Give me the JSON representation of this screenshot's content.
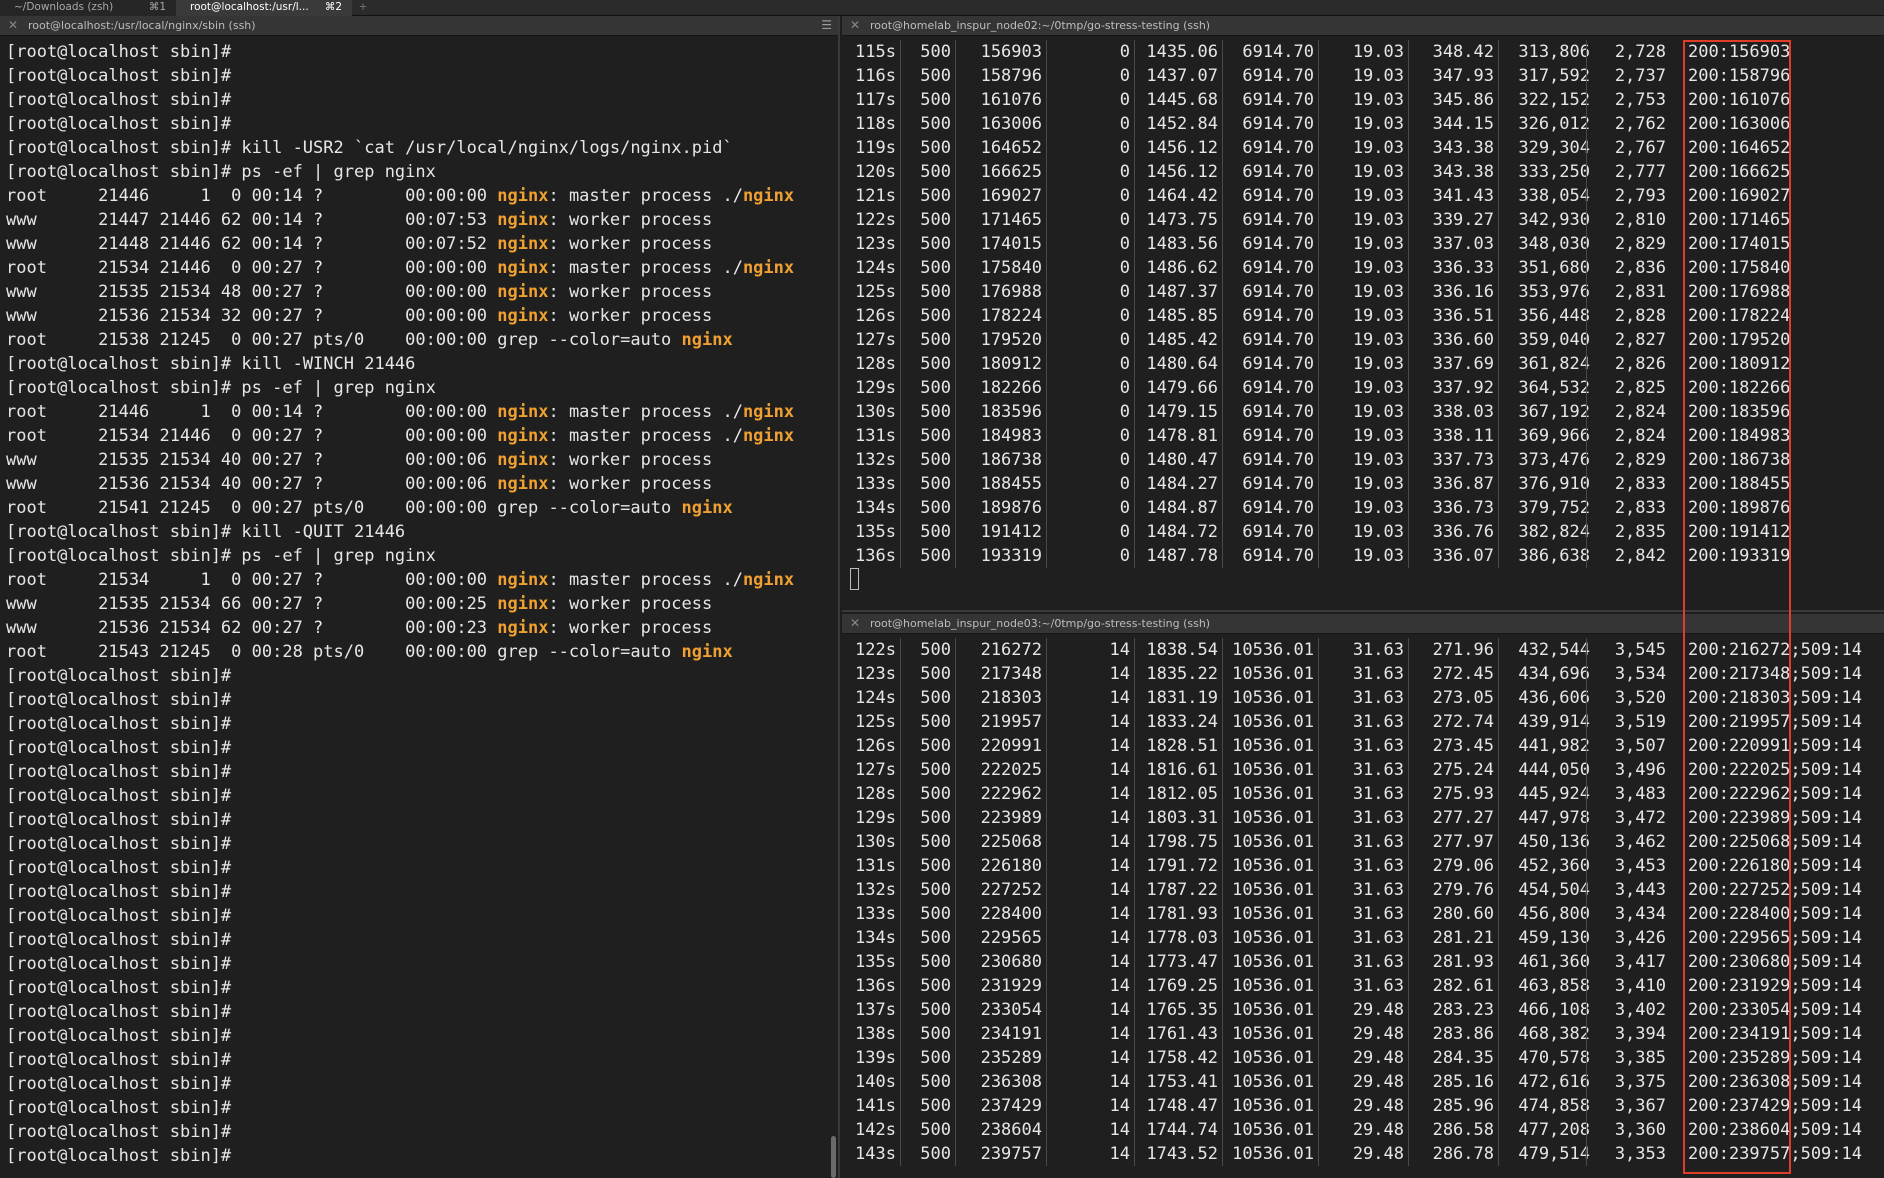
{
  "tabs": [
    {
      "title": "~/Downloads (zsh)",
      "shortcut": "⌘1"
    },
    {
      "title": "root@localhost:/usr/l...",
      "shortcut": "⌘2"
    }
  ],
  "tab_add_label": "+",
  "panes": {
    "left_title": "root@localhost:/usr/local/nginx/sbin (ssh)",
    "top_right_title": "root@homelab_inspur_node02:~/0tmp/go-stress-testing (ssh)",
    "bottom_right_title": "root@homelab_inspur_node03:~/0tmp/go-stress-testing (ssh)"
  },
  "icons": {
    "close": "close-icon",
    "menu": "hamburger-icon"
  },
  "colors": {
    "highlight": "#f0a030",
    "annotation_box": "#e03c28"
  },
  "left_lines": [
    "[root@localhost sbin]#",
    "[root@localhost sbin]#",
    "[root@localhost sbin]#",
    "[root@localhost sbin]#",
    "[root@localhost sbin]# kill -USR2 `cat /usr/local/nginx/logs/nginx.pid`",
    "[root@localhost sbin]# ps -ef | grep nginx",
    "root     21446     1  0 00:14 ?        00:00:00 nginx: master process ./nginx",
    "www      21447 21446 62 00:14 ?        00:07:53 nginx: worker process",
    "www      21448 21446 62 00:14 ?        00:07:52 nginx: worker process",
    "root     21534 21446  0 00:27 ?        00:00:00 nginx: master process ./nginx",
    "www      21535 21534 48 00:27 ?        00:00:00 nginx: worker process",
    "www      21536 21534 32 00:27 ?        00:00:00 nginx: worker process",
    "root     21538 21245  0 00:27 pts/0    00:00:00 grep --color=auto nginx",
    "[root@localhost sbin]# kill -WINCH 21446",
    "[root@localhost sbin]# ps -ef | grep nginx",
    "root     21446     1  0 00:14 ?        00:00:00 nginx: master process ./nginx",
    "root     21534 21446  0 00:27 ?        00:00:00 nginx: master process ./nginx",
    "www      21535 21534 40 00:27 ?        00:00:06 nginx: worker process",
    "www      21536 21534 40 00:27 ?        00:00:06 nginx: worker process",
    "root     21541 21245  0 00:27 pts/0    00:00:00 grep --color=auto nginx",
    "[root@localhost sbin]# kill -QUIT 21446",
    "[root@localhost sbin]# ps -ef | grep nginx",
    "root     21534     1  0 00:27 ?        00:00:00 nginx: master process ./nginx",
    "www      21535 21534 66 00:27 ?        00:00:25 nginx: worker process",
    "www      21536 21534 62 00:27 ?        00:00:23 nginx: worker process",
    "root     21543 21245  0 00:28 pts/0    00:00:00 grep --color=auto nginx",
    "[root@localhost sbin]#",
    "[root@localhost sbin]#",
    "[root@localhost sbin]#",
    "[root@localhost sbin]#",
    "[root@localhost sbin]#",
    "[root@localhost sbin]#",
    "[root@localhost sbin]#",
    "[root@localhost sbin]#",
    "[root@localhost sbin]#",
    "[root@localhost sbin]#",
    "[root@localhost sbin]#",
    "[root@localhost sbin]#",
    "[root@localhost sbin]#",
    "[root@localhost sbin]#",
    "[root@localhost sbin]#",
    "[root@localhost sbin]#",
    "[root@localhost sbin]#",
    "[root@localhost sbin]#",
    "[root@localhost sbin]#",
    "[root@localhost sbin]#",
    "[root@localhost sbin]#"
  ],
  "top_rows": [
    [
      "115s",
      "500",
      "156903",
      "0",
      "1435.06",
      "6914.70",
      "19.03",
      "348.42",
      "313,806",
      "2,728",
      "200:156903"
    ],
    [
      "116s",
      "500",
      "158796",
      "0",
      "1437.07",
      "6914.70",
      "19.03",
      "347.93",
      "317,592",
      "2,737",
      "200:158796"
    ],
    [
      "117s",
      "500",
      "161076",
      "0",
      "1445.68",
      "6914.70",
      "19.03",
      "345.86",
      "322,152",
      "2,753",
      "200:161076"
    ],
    [
      "118s",
      "500",
      "163006",
      "0",
      "1452.84",
      "6914.70",
      "19.03",
      "344.15",
      "326,012",
      "2,762",
      "200:163006"
    ],
    [
      "119s",
      "500",
      "164652",
      "0",
      "1456.12",
      "6914.70",
      "19.03",
      "343.38",
      "329,304",
      "2,767",
      "200:164652"
    ],
    [
      "120s",
      "500",
      "166625",
      "0",
      "1456.12",
      "6914.70",
      "19.03",
      "343.38",
      "333,250",
      "2,777",
      "200:166625"
    ],
    [
      "121s",
      "500",
      "169027",
      "0",
      "1464.42",
      "6914.70",
      "19.03",
      "341.43",
      "338,054",
      "2,793",
      "200:169027"
    ],
    [
      "122s",
      "500",
      "171465",
      "0",
      "1473.75",
      "6914.70",
      "19.03",
      "339.27",
      "342,930",
      "2,810",
      "200:171465"
    ],
    [
      "123s",
      "500",
      "174015",
      "0",
      "1483.56",
      "6914.70",
      "19.03",
      "337.03",
      "348,030",
      "2,829",
      "200:174015"
    ],
    [
      "124s",
      "500",
      "175840",
      "0",
      "1486.62",
      "6914.70",
      "19.03",
      "336.33",
      "351,680",
      "2,836",
      "200:175840"
    ],
    [
      "125s",
      "500",
      "176988",
      "0",
      "1487.37",
      "6914.70",
      "19.03",
      "336.16",
      "353,976",
      "2,831",
      "200:176988"
    ],
    [
      "126s",
      "500",
      "178224",
      "0",
      "1485.85",
      "6914.70",
      "19.03",
      "336.51",
      "356,448",
      "2,828",
      "200:178224"
    ],
    [
      "127s",
      "500",
      "179520",
      "0",
      "1485.42",
      "6914.70",
      "19.03",
      "336.60",
      "359,040",
      "2,827",
      "200:179520"
    ],
    [
      "128s",
      "500",
      "180912",
      "0",
      "1480.64",
      "6914.70",
      "19.03",
      "337.69",
      "361,824",
      "2,826",
      "200:180912"
    ],
    [
      "129s",
      "500",
      "182266",
      "0",
      "1479.66",
      "6914.70",
      "19.03",
      "337.92",
      "364,532",
      "2,825",
      "200:182266"
    ],
    [
      "130s",
      "500",
      "183596",
      "0",
      "1479.15",
      "6914.70",
      "19.03",
      "338.03",
      "367,192",
      "2,824",
      "200:183596"
    ],
    [
      "131s",
      "500",
      "184983",
      "0",
      "1478.81",
      "6914.70",
      "19.03",
      "338.11",
      "369,966",
      "2,824",
      "200:184983"
    ],
    [
      "132s",
      "500",
      "186738",
      "0",
      "1480.47",
      "6914.70",
      "19.03",
      "337.73",
      "373,476",
      "2,829",
      "200:186738"
    ],
    [
      "133s",
      "500",
      "188455",
      "0",
      "1484.27",
      "6914.70",
      "19.03",
      "336.87",
      "376,910",
      "2,833",
      "200:188455"
    ],
    [
      "134s",
      "500",
      "189876",
      "0",
      "1484.87",
      "6914.70",
      "19.03",
      "336.73",
      "379,752",
      "2,833",
      "200:189876"
    ],
    [
      "135s",
      "500",
      "191412",
      "0",
      "1484.72",
      "6914.70",
      "19.03",
      "336.76",
      "382,824",
      "2,835",
      "200:191412"
    ],
    [
      "136s",
      "500",
      "193319",
      "0",
      "1487.78",
      "6914.70",
      "19.03",
      "336.07",
      "386,638",
      "2,842",
      "200:193319"
    ]
  ],
  "bottom_rows": [
    [
      "122s",
      "500",
      "216272",
      "14",
      "1838.54",
      "10536.01",
      "31.63",
      "271.96",
      "432,544",
      "3,545",
      "200:216272;509:14"
    ],
    [
      "123s",
      "500",
      "217348",
      "14",
      "1835.22",
      "10536.01",
      "31.63",
      "272.45",
      "434,696",
      "3,534",
      "200:217348;509:14"
    ],
    [
      "124s",
      "500",
      "218303",
      "14",
      "1831.19",
      "10536.01",
      "31.63",
      "273.05",
      "436,606",
      "3,520",
      "200:218303;509:14"
    ],
    [
      "125s",
      "500",
      "219957",
      "14",
      "1833.24",
      "10536.01",
      "31.63",
      "272.74",
      "439,914",
      "3,519",
      "200:219957;509:14"
    ],
    [
      "126s",
      "500",
      "220991",
      "14",
      "1828.51",
      "10536.01",
      "31.63",
      "273.45",
      "441,982",
      "3,507",
      "200:220991;509:14"
    ],
    [
      "127s",
      "500",
      "222025",
      "14",
      "1816.61",
      "10536.01",
      "31.63",
      "275.24",
      "444,050",
      "3,496",
      "200:222025;509:14"
    ],
    [
      "128s",
      "500",
      "222962",
      "14",
      "1812.05",
      "10536.01",
      "31.63",
      "275.93",
      "445,924",
      "3,483",
      "200:222962;509:14"
    ],
    [
      "129s",
      "500",
      "223989",
      "14",
      "1803.31",
      "10536.01",
      "31.63",
      "277.27",
      "447,978",
      "3,472",
      "200:223989;509:14"
    ],
    [
      "130s",
      "500",
      "225068",
      "14",
      "1798.75",
      "10536.01",
      "31.63",
      "277.97",
      "450,136",
      "3,462",
      "200:225068;509:14"
    ],
    [
      "131s",
      "500",
      "226180",
      "14",
      "1791.72",
      "10536.01",
      "31.63",
      "279.06",
      "452,360",
      "3,453",
      "200:226180;509:14"
    ],
    [
      "132s",
      "500",
      "227252",
      "14",
      "1787.22",
      "10536.01",
      "31.63",
      "279.76",
      "454,504",
      "3,443",
      "200:227252;509:14"
    ],
    [
      "133s",
      "500",
      "228400",
      "14",
      "1781.93",
      "10536.01",
      "31.63",
      "280.60",
      "456,800",
      "3,434",
      "200:228400;509:14"
    ],
    [
      "134s",
      "500",
      "229565",
      "14",
      "1778.03",
      "10536.01",
      "31.63",
      "281.21",
      "459,130",
      "3,426",
      "200:229565;509:14"
    ],
    [
      "135s",
      "500",
      "230680",
      "14",
      "1773.47",
      "10536.01",
      "31.63",
      "281.93",
      "461,360",
      "3,417",
      "200:230680;509:14"
    ],
    [
      "136s",
      "500",
      "231929",
      "14",
      "1769.25",
      "10536.01",
      "31.63",
      "282.61",
      "463,858",
      "3,410",
      "200:231929;509:14"
    ],
    [
      "137s",
      "500",
      "233054",
      "14",
      "1765.35",
      "10536.01",
      "29.48",
      "283.23",
      "466,108",
      "3,402",
      "200:233054;509:14"
    ],
    [
      "138s",
      "500",
      "234191",
      "14",
      "1761.43",
      "10536.01",
      "29.48",
      "283.86",
      "468,382",
      "3,394",
      "200:234191;509:14"
    ],
    [
      "139s",
      "500",
      "235289",
      "14",
      "1758.42",
      "10536.01",
      "29.48",
      "284.35",
      "470,578",
      "3,385",
      "200:235289;509:14"
    ],
    [
      "140s",
      "500",
      "236308",
      "14",
      "1753.41",
      "10536.01",
      "29.48",
      "285.16",
      "472,616",
      "3,375",
      "200:236308;509:14"
    ],
    [
      "141s",
      "500",
      "237429",
      "14",
      "1748.47",
      "10536.01",
      "29.48",
      "285.96",
      "474,858",
      "3,367",
      "200:237429;509:14"
    ],
    [
      "142s",
      "500",
      "238604",
      "14",
      "1744.74",
      "10536.01",
      "29.48",
      "286.58",
      "477,208",
      "3,360",
      "200:238604;509:14"
    ],
    [
      "143s",
      "500",
      "239757",
      "14",
      "1743.52",
      "10536.01",
      "29.48",
      "286.78",
      "479,514",
      "3,353",
      "200:239757;509:14"
    ]
  ]
}
